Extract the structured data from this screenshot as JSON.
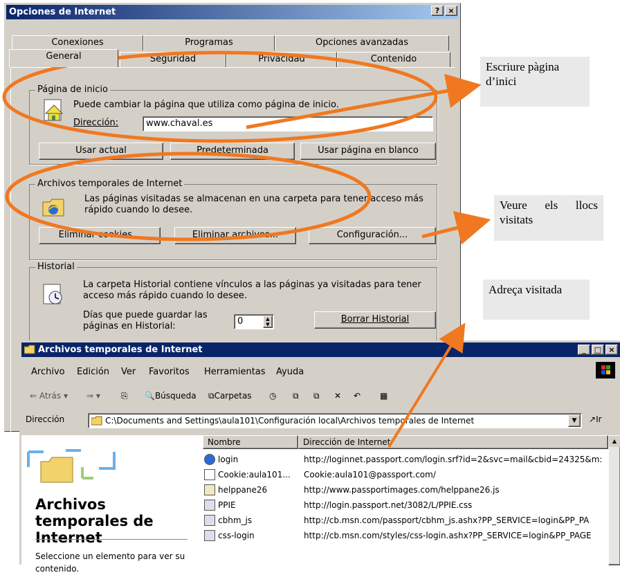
{
  "dialog": {
    "title": "Opciones de Internet",
    "help_btn": "?",
    "close_btn": "×",
    "tabs_back": [
      "Conexiones",
      "Programas",
      "Opciones avanzadas"
    ],
    "tabs_front": [
      "General",
      "Seguridad",
      "Privacidad",
      "Contenido"
    ],
    "home": {
      "label": "Página de inicio",
      "desc": "Puede cambiar la página que utiliza como página de inicio.",
      "address_label": "Dirección:",
      "address_value": "www.chaval.es",
      "btn_current": "Usar actual",
      "btn_default": "Predeterminada",
      "btn_blank": "Usar página en blanco"
    },
    "temp": {
      "label": "Archivos temporales de Internet",
      "desc": "Las páginas visitadas se almacenan en una carpeta para tener acceso más rápido cuando lo desee.",
      "btn_cookies": "Eliminar cookies...",
      "btn_files": "Eliminar archivos...",
      "btn_config": "Configuración..."
    },
    "history": {
      "label": "Historial",
      "desc": "La carpeta Historial contiene vínculos a las páginas ya visitadas para tener acceso más rápido cuando lo desee.",
      "days_label": "Días que puede guardar las páginas en Historial:",
      "days_value": "0",
      "btn_clear": "Borrar Historial"
    }
  },
  "window": {
    "title": "Archivos temporales de Internet",
    "menu": [
      "Archivo",
      "Edición",
      "Ver",
      "Favoritos",
      "Herramientas",
      "Ayuda"
    ],
    "toolbar": {
      "back": "Atrás",
      "search": "Búsqueda",
      "folders": "Carpetas"
    },
    "address_label": "Dirección",
    "address_value": "C:\\Documents and Settings\\aula101\\Configuración local\\Archivos temporales de Internet",
    "go_label": "Ir",
    "side_title": "Archivos temporales de Internet",
    "side_hint": "Seleccione un elemento para ver su contenido.",
    "columns": [
      "Nombre",
      "Dirección de Internet"
    ],
    "rows": [
      {
        "name": "login",
        "url": "http://loginnet.passport.com/login.srf?id=2&svc=mail&cbid=24325&m:"
      },
      {
        "name": "Cookie:aula101...",
        "url": "Cookie:aula101@passport.com/"
      },
      {
        "name": "helppane26",
        "url": "http://www.passportimages.com/helppane26.js"
      },
      {
        "name": "PPIE",
        "url": "http://login.passport.net/3082/L/PPIE.css"
      },
      {
        "name": "cbhm_js",
        "url": "http://cb.msn.com/passport/cbhm_js.ashx?PP_SERVICE=login&PP_PA"
      },
      {
        "name": "css-login",
        "url": "http://cb.msn.com/styles/css-login.ashx?PP_SERVICE=login&PP_PAGE"
      }
    ]
  },
  "callouts": {
    "home": "Escriure pàgina d’inici",
    "visited": "Veure els llocs visitats",
    "address": "Adreça visitada"
  },
  "colors": {
    "annotation": "#f07820",
    "titlebar": "#0a246a",
    "face": "#d4d0c8"
  }
}
